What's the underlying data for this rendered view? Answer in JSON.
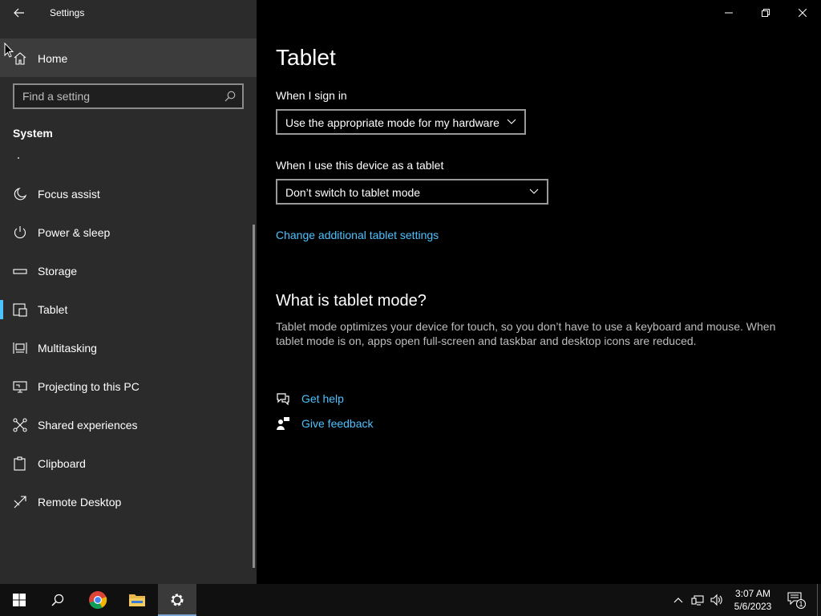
{
  "window": {
    "title": "Settings"
  },
  "sidebar": {
    "home_label": "Home",
    "search_placeholder": "Find a setting",
    "section": "System",
    "items": [
      {
        "label": "Focus assist",
        "icon": "moon-icon"
      },
      {
        "label": "Power & sleep",
        "icon": "power-icon"
      },
      {
        "label": "Storage",
        "icon": "storage-icon"
      },
      {
        "label": "Tablet",
        "icon": "tablet-icon",
        "active": true
      },
      {
        "label": "Multitasking",
        "icon": "multitasking-icon"
      },
      {
        "label": "Projecting to this PC",
        "icon": "projecting-icon"
      },
      {
        "label": "Shared experiences",
        "icon": "shared-experiences-icon"
      },
      {
        "label": "Clipboard",
        "icon": "clipboard-icon"
      },
      {
        "label": "Remote Desktop",
        "icon": "remote-desktop-icon"
      }
    ]
  },
  "main": {
    "title": "Tablet",
    "sign_in_label": "When I sign in",
    "sign_in_value": "Use the appropriate mode for my hardware",
    "device_label": "When I use this device as a tablet",
    "device_value": "Don’t switch to tablet mode",
    "additional_link": "Change additional tablet settings",
    "what_heading": "What is tablet mode?",
    "what_desc": "Tablet mode optimizes your device for touch, so you don’t have to use a keyboard and mouse. When tablet mode is on, apps open full-screen and taskbar and desktop icons are reduced.",
    "get_help": "Get help",
    "give_feedback": "Give feedback"
  },
  "taskbar": {
    "time": "3:07 AM",
    "date": "5/6/2023",
    "notification_count": "1"
  },
  "colors": {
    "accent": "#4cc2ff",
    "sidebar_bg": "#2b2b2b",
    "main_bg": "#000000",
    "taskbar_bg": "#101010"
  }
}
